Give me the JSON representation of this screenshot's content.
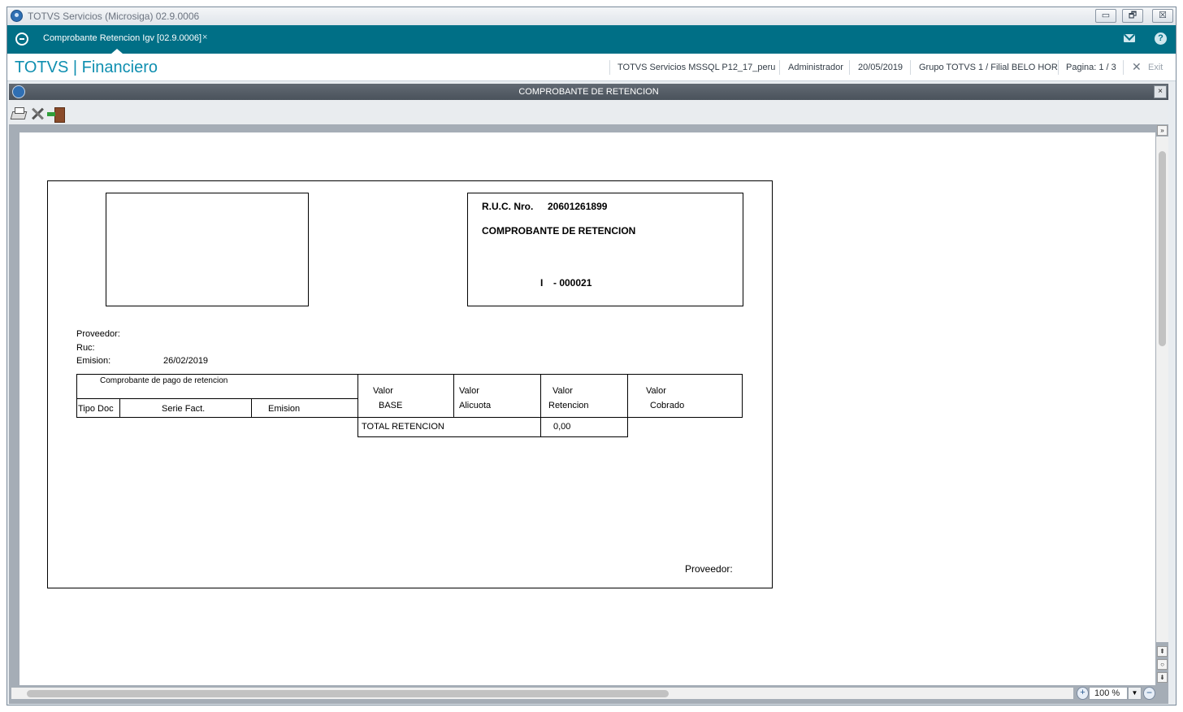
{
  "window": {
    "title": "TOTVS Servicios (Microsiga) 02.9.0006",
    "minimize": "▭",
    "restore": "🗗",
    "close": "☒"
  },
  "tabbar": {
    "active_tab_label": "Comprobante Retencion Igv [02.9.0006]",
    "tab_close": "×",
    "help_symbol": "?"
  },
  "module_bar": {
    "title": "TOTVS | Financiero",
    "environment": "TOTVS Servicios MSSQL P12_17_peru",
    "user": "Administrador",
    "date": "20/05/2019",
    "branch": "Grupo TOTVS 1 / Filial BELO HOR",
    "page": "Pagina: 1 / 3",
    "exit_symbol": "✕",
    "exit_label": "Exit"
  },
  "dialog": {
    "title": "COMPROBANTE DE RETENCION",
    "close_symbol": "×"
  },
  "toolbar": {
    "icons": [
      "printer-icon",
      "tools-icon",
      "exit-door-icon"
    ]
  },
  "preview": {
    "zoom": "100 %",
    "zoom_in_symbol": "+",
    "zoom_out_symbol": "−",
    "scroll_first": "⇞",
    "scroll_center": "○",
    "scroll_last": "⇟",
    "panel_toggle": "»",
    "dropdown_symbol": "▼"
  },
  "document": {
    "ruc_label": "R.U.C. Nro.",
    "ruc_value": "20601261899",
    "doc_title": "COMPROBANTE DE RETENCION",
    "doc_series": "I",
    "doc_number": "- 000021",
    "proveedor_label": "Proveedor:",
    "ruc_field_label": "Ruc:",
    "emision_label": "Emision:",
    "emision_value": "26/02/2019",
    "table": {
      "group_header": "Comprobante de pago de retencion",
      "col_tipo_doc": "Tipo Doc",
      "col_serie_fact": "Serie Fact.",
      "col_emision": "Emision",
      "col_base_1": "Valor",
      "col_base_2": "BASE",
      "col_alicuota_1": "Valor",
      "col_alicuota_2": "Alicuota",
      "col_retencion_1": "Valor",
      "col_retencion_2": "Retencion",
      "col_cobrado_1": "Valor",
      "col_cobrado_2": "Cobrado",
      "total_label": "TOTAL RETENCION",
      "total_value": "0,00"
    },
    "footer_proveedor": "Proveedor:"
  }
}
